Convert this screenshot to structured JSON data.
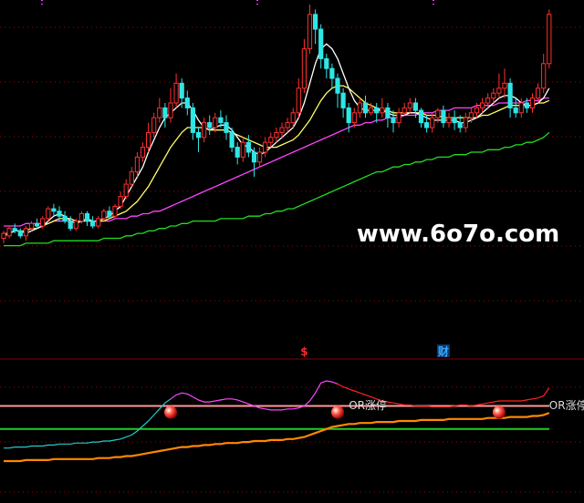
{
  "watermark": "www.6o7o.com",
  "event_markers": [
    {
      "glyph": "$",
      "candle_index": 54,
      "color": "#ff2a2a"
    },
    {
      "glyph": "财",
      "candle_index": 79,
      "color": "#3aa7ff"
    }
  ],
  "indicator_labels": [
    {
      "text": "OR涨停",
      "at_index": 62
    },
    {
      "text": "OR涨停",
      "at_index": 98
    }
  ],
  "signal_balls": [
    30,
    60,
    89
  ],
  "colors": {
    "up": "#ff3030",
    "down": "#2ee6e6",
    "ma_short": "#ffffff",
    "ma_mid": "#ffff66",
    "ma_long": "#ff44ff",
    "ma_base": "#22dd22",
    "grid": "#aa0000",
    "ind_upper": "#ff9999",
    "ind_lower": "#22cc22",
    "ind_cyan": "#22cccc",
    "ind_magenta": "#ff44ff",
    "ind_red": "#ff2222",
    "ind_orange": "#ff8800",
    "label": "#dddddd"
  },
  "chart_data": {
    "type": "candlestick",
    "price_range": [
      0,
      100
    ],
    "indicator_range": [
      0,
      100
    ],
    "candles": [
      [
        5,
        7,
        3,
        8
      ],
      [
        6,
        9,
        5,
        10
      ],
      [
        9,
        8,
        7,
        11
      ],
      [
        8,
        6,
        5,
        9
      ],
      [
        6,
        9,
        4,
        10
      ],
      [
        9,
        11,
        8,
        12
      ],
      [
        11,
        10,
        9,
        13
      ],
      [
        10,
        13,
        9,
        14
      ],
      [
        13,
        17,
        12,
        18
      ],
      [
        17,
        16,
        14,
        19
      ],
      [
        16,
        14,
        12,
        18
      ],
      [
        14,
        12,
        11,
        16
      ],
      [
        12,
        9,
        8,
        14
      ],
      [
        9,
        12,
        8,
        13
      ],
      [
        12,
        15,
        11,
        16
      ],
      [
        15,
        12,
        10,
        16
      ],
      [
        12,
        10,
        9,
        14
      ],
      [
        10,
        13,
        9,
        14
      ],
      [
        13,
        16,
        12,
        17
      ],
      [
        16,
        14,
        13,
        18
      ],
      [
        14,
        18,
        13,
        19
      ],
      [
        18,
        22,
        17,
        24
      ],
      [
        22,
        27,
        21,
        29
      ],
      [
        27,
        32,
        26,
        34
      ],
      [
        32,
        38,
        30,
        40
      ],
      [
        38,
        42,
        36,
        44
      ],
      [
        42,
        48,
        40,
        52
      ],
      [
        48,
        54,
        46,
        56
      ],
      [
        54,
        58,
        52,
        62
      ],
      [
        58,
        54,
        50,
        60
      ],
      [
        54,
        60,
        52,
        66
      ],
      [
        60,
        68,
        58,
        72
      ],
      [
        68,
        62,
        58,
        70
      ],
      [
        62,
        58,
        55,
        65
      ],
      [
        58,
        48,
        45,
        60
      ],
      [
        48,
        46,
        40,
        50
      ],
      [
        46,
        52,
        44,
        54
      ],
      [
        52,
        50,
        47,
        55
      ],
      [
        50,
        54,
        48,
        56
      ],
      [
        54,
        52,
        50,
        57
      ],
      [
        52,
        48,
        45,
        55
      ],
      [
        48,
        42,
        40,
        50
      ],
      [
        42,
        38,
        35,
        44
      ],
      [
        38,
        44,
        36,
        46
      ],
      [
        44,
        40,
        38,
        47
      ],
      [
        40,
        36,
        30,
        42
      ],
      [
        36,
        40,
        34,
        42
      ],
      [
        40,
        44,
        38,
        46
      ],
      [
        44,
        46,
        42,
        48
      ],
      [
        46,
        48,
        44,
        50
      ],
      [
        48,
        50,
        46,
        52
      ],
      [
        50,
        52,
        48,
        54
      ],
      [
        52,
        56,
        50,
        58
      ],
      [
        56,
        66,
        54,
        70
      ],
      [
        66,
        82,
        64,
        86
      ],
      [
        82,
        96,
        80,
        100
      ],
      [
        96,
        90,
        84,
        98
      ],
      [
        90,
        78,
        74,
        92
      ],
      [
        78,
        74,
        70,
        80
      ],
      [
        74,
        70,
        66,
        76
      ],
      [
        70,
        64,
        58,
        72
      ],
      [
        64,
        58,
        54,
        66
      ],
      [
        58,
        52,
        48,
        60
      ],
      [
        52,
        56,
        50,
        58
      ],
      [
        56,
        60,
        54,
        62
      ],
      [
        60,
        56,
        54,
        63
      ],
      [
        56,
        58,
        55,
        60
      ],
      [
        58,
        56,
        52,
        60
      ],
      [
        56,
        58,
        54,
        62
      ],
      [
        58,
        54,
        50,
        60
      ],
      [
        54,
        52,
        48,
        57
      ],
      [
        52,
        56,
        50,
        58
      ],
      [
        56,
        58,
        55,
        60
      ],
      [
        58,
        60,
        56,
        62
      ],
      [
        60,
        57,
        54,
        62
      ],
      [
        57,
        52,
        50,
        58
      ],
      [
        52,
        50,
        48,
        55
      ],
      [
        50,
        54,
        48,
        56
      ],
      [
        54,
        57,
        52,
        58
      ],
      [
        57,
        52,
        50,
        59
      ],
      [
        52,
        54,
        50,
        56
      ],
      [
        54,
        52,
        49,
        57
      ],
      [
        52,
        50,
        48,
        55
      ],
      [
        50,
        54,
        48,
        56
      ],
      [
        54,
        56,
        52,
        58
      ],
      [
        56,
        58,
        54,
        60
      ],
      [
        58,
        60,
        56,
        62
      ],
      [
        60,
        62,
        58,
        64
      ],
      [
        62,
        64,
        60,
        66
      ],
      [
        64,
        66,
        62,
        72
      ],
      [
        66,
        68,
        62,
        74
      ],
      [
        68,
        58,
        54,
        70
      ],
      [
        58,
        56,
        54,
        62
      ],
      [
        56,
        60,
        54,
        62
      ],
      [
        60,
        58,
        56,
        62
      ],
      [
        58,
        62,
        56,
        64
      ],
      [
        62,
        66,
        60,
        68
      ],
      [
        66,
        76,
        64,
        80
      ],
      [
        76,
        96,
        74,
        98
      ]
    ],
    "ma_short": [
      6,
      7,
      8,
      8,
      7,
      8,
      9,
      10,
      12,
      14,
      15,
      14,
      12,
      11,
      12,
      13,
      12,
      12,
      13,
      14,
      16,
      18,
      22,
      26,
      30,
      34,
      40,
      45,
      50,
      54,
      56,
      58,
      60,
      60,
      57,
      53,
      50,
      49,
      50,
      51,
      51,
      49,
      46,
      43,
      42,
      40,
      39,
      40,
      42,
      44,
      46,
      48,
      50,
      54,
      60,
      68,
      76,
      82,
      84,
      82,
      78,
      72,
      66,
      61,
      58,
      57,
      57,
      57,
      57,
      56,
      55,
      55,
      55,
      56,
      56,
      55,
      54,
      53,
      53,
      53,
      53,
      53,
      52,
      52,
      53,
      54,
      56,
      58,
      60,
      62,
      63,
      63,
      62,
      60,
      59,
      59,
      60,
      62,
      66
    ],
    "ma_mid": [
      7,
      7,
      8,
      8,
      8,
      9,
      9,
      10,
      11,
      12,
      13,
      13,
      13,
      12,
      12,
      12,
      12,
      12,
      12,
      13,
      14,
      15,
      16,
      18,
      20,
      23,
      26,
      30,
      34,
      38,
      42,
      45,
      48,
      50,
      50,
      50,
      50,
      49,
      49,
      49,
      49,
      48,
      47,
      46,
      45,
      44,
      43,
      42,
      42,
      42,
      43,
      44,
      45,
      47,
      50,
      53,
      57,
      61,
      64,
      66,
      67,
      67,
      66,
      64,
      62,
      60,
      59,
      58,
      57,
      57,
      56,
      56,
      56,
      56,
      56,
      56,
      55,
      55,
      55,
      54,
      54,
      54,
      54,
      54,
      54,
      54,
      55,
      55,
      56,
      57,
      58,
      59,
      59,
      59,
      59,
      59,
      60,
      60,
      61
    ],
    "ma_long": [
      10,
      10,
      10,
      10,
      11,
      11,
      11,
      11,
      11,
      12,
      12,
      12,
      12,
      12,
      12,
      12,
      12,
      12,
      12,
      12,
      13,
      13,
      13,
      14,
      14,
      15,
      15,
      16,
      16,
      17,
      18,
      19,
      20,
      21,
      22,
      23,
      24,
      25,
      26,
      27,
      28,
      29,
      30,
      31,
      32,
      33,
      34,
      35,
      36,
      37,
      38,
      39,
      40,
      41,
      42,
      43,
      44,
      45,
      46,
      47,
      48,
      49,
      50,
      51,
      51,
      52,
      52,
      53,
      53,
      54,
      54,
      54,
      55,
      55,
      55,
      56,
      56,
      56,
      57,
      57,
      57,
      58,
      58,
      58,
      58,
      59,
      59,
      59,
      59,
      60,
      60,
      60,
      60,
      60,
      61,
      61,
      61,
      62,
      62
    ],
    "ma_base": [
      2,
      2,
      2,
      2,
      3,
      3,
      3,
      3,
      3,
      4,
      4,
      4,
      4,
      4,
      4,
      4,
      4,
      4,
      5,
      5,
      5,
      5,
      6,
      6,
      7,
      7,
      8,
      8,
      9,
      9,
      10,
      10,
      11,
      11,
      12,
      12,
      12,
      12,
      12,
      13,
      13,
      13,
      13,
      13,
      14,
      14,
      14,
      15,
      15,
      16,
      16,
      17,
      17,
      18,
      19,
      20,
      21,
      22,
      23,
      24,
      25,
      26,
      27,
      28,
      29,
      30,
      31,
      32,
      32,
      33,
      34,
      34,
      35,
      35,
      36,
      36,
      37,
      37,
      38,
      38,
      38,
      39,
      39,
      39,
      40,
      40,
      40,
      41,
      41,
      41,
      42,
      42,
      43,
      43,
      44,
      44,
      45,
      46,
      48
    ],
    "indicator": {
      "upper_level": 75,
      "lower_level": 52,
      "ind_line": [
        33,
        33,
        34,
        34,
        34,
        35,
        35,
        35,
        36,
        36,
        37,
        37,
        37,
        38,
        38,
        38,
        39,
        39,
        40,
        40,
        41,
        42,
        44,
        46,
        50,
        55,
        60,
        66,
        72,
        78,
        82,
        86,
        88,
        87,
        84,
        81,
        79,
        79,
        80,
        81,
        82,
        82,
        81,
        79,
        77,
        75,
        73,
        72,
        71,
        71,
        71,
        72,
        72,
        73,
        75,
        80,
        88,
        98,
        100,
        99,
        97,
        94,
        92,
        90,
        88,
        86,
        84,
        82,
        80,
        79,
        78,
        77,
        76,
        76,
        75,
        75,
        75,
        74,
        74,
        74,
        74,
        75,
        76,
        76,
        75,
        76,
        77,
        78,
        79,
        80,
        80,
        80,
        80,
        80,
        81,
        82,
        83,
        85,
        93
      ],
      "base_line": [
        20,
        20,
        20,
        20,
        21,
        21,
        21,
        21,
        21,
        22,
        22,
        22,
        22,
        22,
        22,
        22,
        22,
        23,
        23,
        23,
        24,
        24,
        25,
        25,
        26,
        27,
        28,
        29,
        30,
        31,
        32,
        33,
        34,
        34,
        35,
        35,
        36,
        36,
        37,
        37,
        38,
        38,
        38,
        39,
        39,
        40,
        40,
        40,
        41,
        41,
        41,
        42,
        42,
        43,
        44,
        46,
        48,
        50,
        52,
        54,
        55,
        56,
        57,
        57,
        58,
        58,
        58,
        59,
        59,
        59,
        59,
        60,
        60,
        60,
        60,
        61,
        61,
        61,
        61,
        61,
        62,
        62,
        62,
        62,
        62,
        62,
        62,
        63,
        63,
        63,
        63,
        64,
        64,
        64,
        64,
        65,
        65,
        66,
        68
      ]
    }
  }
}
